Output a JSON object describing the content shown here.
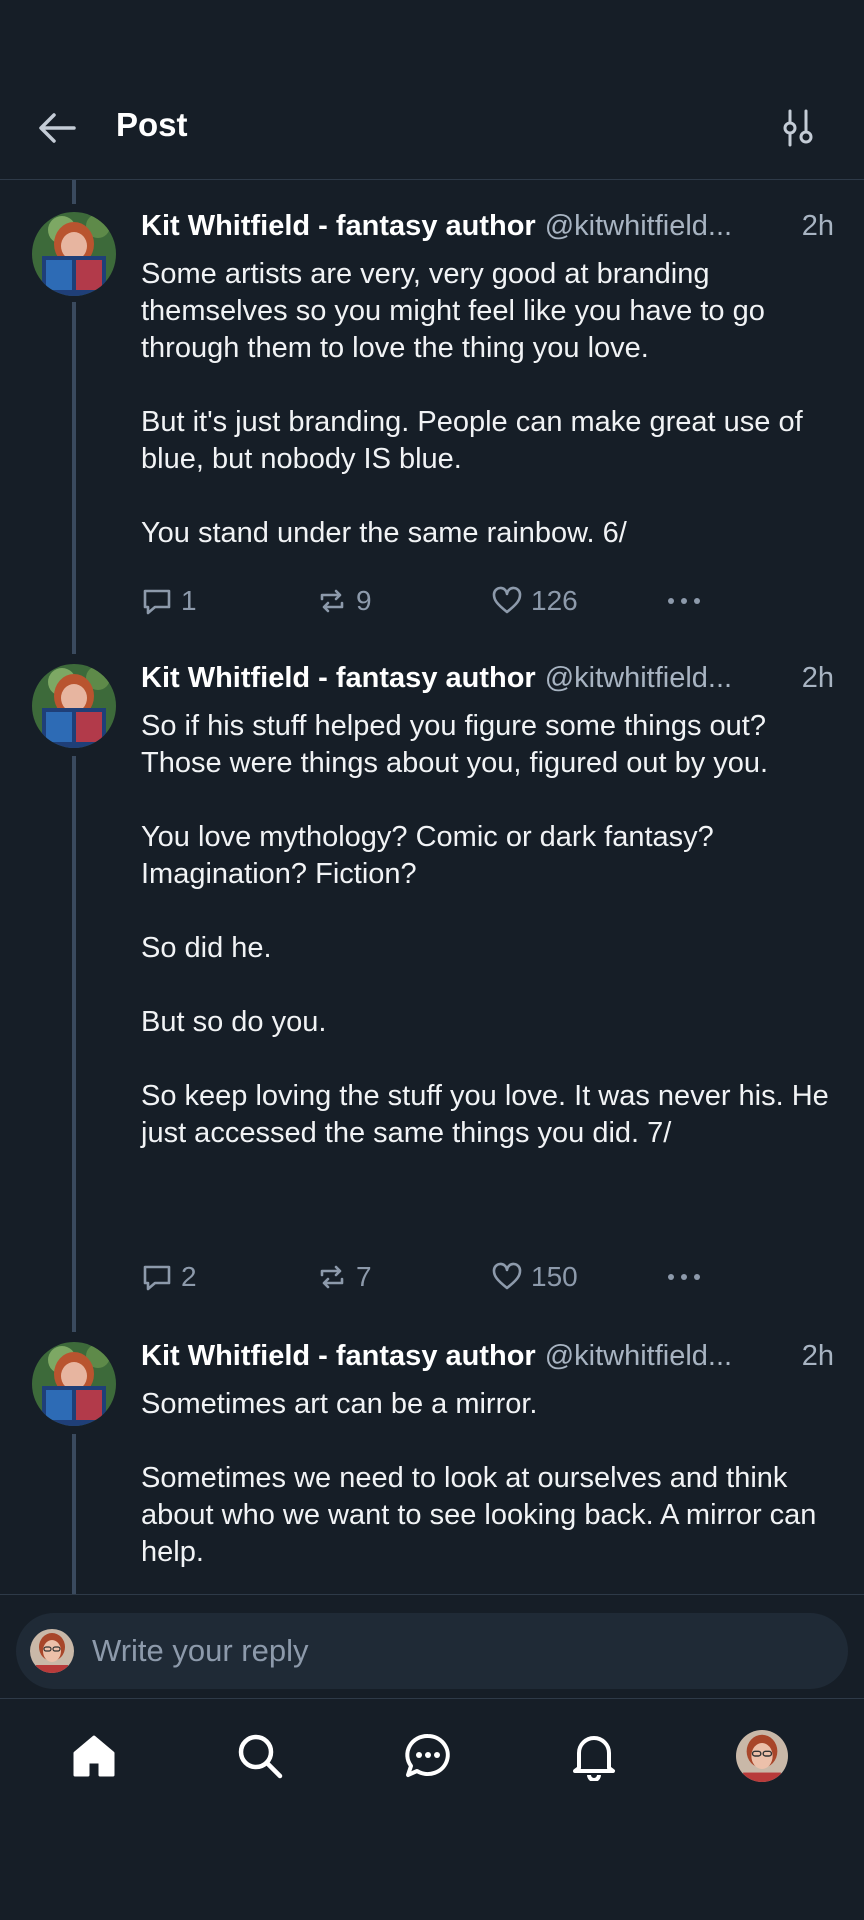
{
  "header": {
    "title": "Post"
  },
  "posts": [
    {
      "author": "Kit Whitfield - fantasy author",
      "handle": "@kitwhitfield...",
      "time": "2h",
      "paragraphs": [
        "Some artists are very, very good at branding themselves so you might feel like you have to go through them to love the thing you love.",
        "But it's just branding. People can make great use of blue, but nobody IS blue.",
        "You stand under the same rainbow. 6/"
      ],
      "replies": "1",
      "reposts": "9",
      "likes": "126"
    },
    {
      "author": "Kit Whitfield - fantasy author",
      "handle": "@kitwhitfield...",
      "time": "2h",
      "paragraphs": [
        "So if his stuff helped you figure some things out? Those were things about you, figured out by you.",
        "You love mythology? Comic or dark fantasy? Imagination? Fiction?",
        "So did he.",
        "But so do you.",
        "So keep loving the stuff you love. It was never his. He just accessed the same things you did. 7/"
      ],
      "replies": "2",
      "reposts": "7",
      "likes": "150"
    },
    {
      "author": "Kit Whitfield - fantasy author",
      "handle": "@kitwhitfield...",
      "time": "2h",
      "paragraphs": [
        "Sometimes art can be a mirror.",
        "Sometimes we need to look at ourselves and think about who we want to see looking back. A mirror can help."
      ]
    }
  ],
  "reply": {
    "placeholder": "Write your reply"
  },
  "nav": [
    "home-icon",
    "search-icon",
    "chat-icon",
    "bell-icon",
    "profile-avatar"
  ],
  "colors": {
    "background": "#161e27",
    "muted": "#8d9aab",
    "thread_line": "#3a4a5e"
  }
}
